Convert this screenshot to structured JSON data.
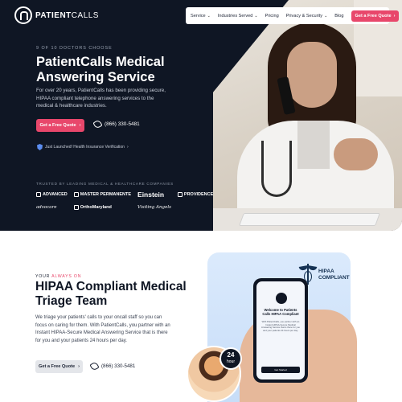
{
  "brand": {
    "name_bold": "PATIENT",
    "name_light": "CALLS"
  },
  "nav": {
    "items": [
      {
        "label": "Service",
        "has_dropdown": true
      },
      {
        "label": "Industries Served",
        "has_dropdown": true
      },
      {
        "label": "Pricing",
        "has_dropdown": false
      },
      {
        "label": "Privacy & Security",
        "has_dropdown": true
      },
      {
        "label": "Blog",
        "has_dropdown": false
      }
    ],
    "cta": "Get a Free Quote"
  },
  "hero": {
    "eyebrow": "9 OF 10 DOCTORS CHOOSE",
    "title": "PatientCalls Medical Answering Service",
    "lead": "For over 20 years, PatientCalls has been providing secure, HIPAA compliant telephone answering services to the medical & healthcare industries.",
    "cta": "Get a Free Quote",
    "phone": "(866) 330-5481",
    "verify": "Just Launched! Health Insurance Verification",
    "trusted": "TRUSTED BY LEADING MEDICAL & HEALTHCARE COMPANIES",
    "logos": [
      "ADVANCED",
      "MASTER PERMANENTE",
      "Einstein",
      "PROVIDENCE",
      "advocare",
      "OrthoMaryland",
      "Visiting Angels"
    ]
  },
  "triage": {
    "eyebrow_a": "YOUR",
    "eyebrow_b": "ALWAYS ON",
    "title": "HIPAA Compliant Medical Triage Team",
    "body": "We triage your patients' calls to your oncall staff so you can focus on caring for them. With PatientCalls, you partner with an Instant HIPAA-Secure Medical Answering Service that is there for you and your patients 24 hours per day.",
    "cta": "Get a Free Quote",
    "phone": "(866) 330-5481",
    "hipaa_line1": "HIPAA",
    "hipaa_line2": "COMPLIANT",
    "badge_num": "24",
    "badge_unit": "hour",
    "screen_title": "Welcome to Patients Calls HIPAA Compliant",
    "screen_body": "With PatientCalls, you partner with an Instant HIPAA-Secure Medical Answering Service that is there for you and your patients 24 hours per day.",
    "screen_button": "Get Started"
  },
  "colors": {
    "navy": "#0f1624",
    "accent_pink": "#e8476b",
    "panel_blue": "#dbeafc"
  }
}
